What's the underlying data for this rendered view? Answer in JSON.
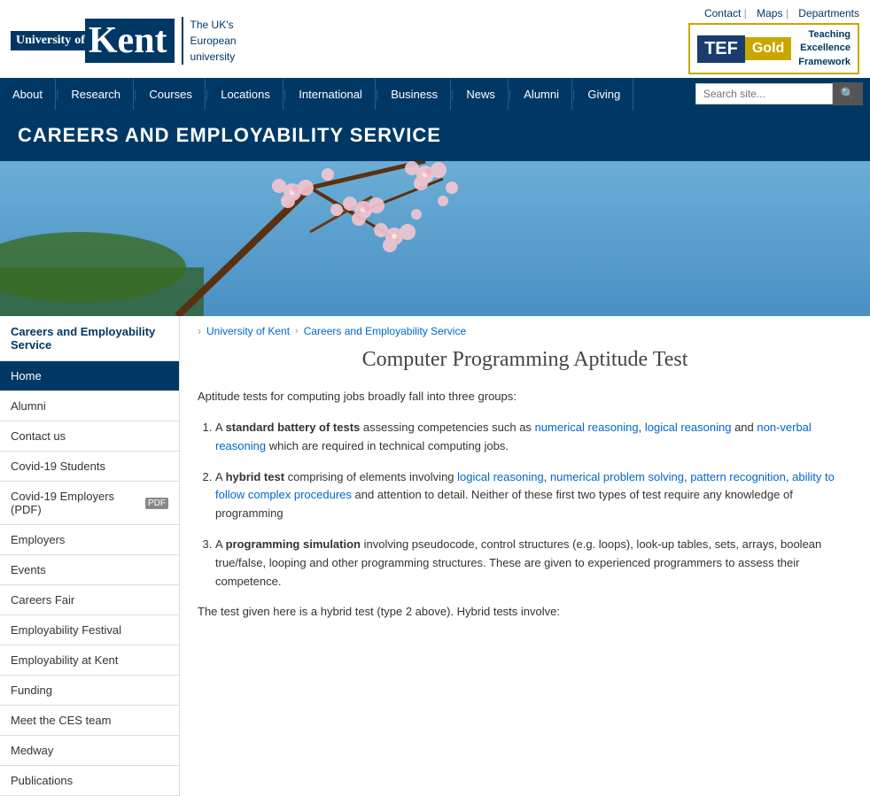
{
  "header": {
    "university_name": "Kent",
    "university_tagline_line1": "The UK's",
    "university_tagline_line2": "European",
    "university_tagline_line3": "university",
    "top_links": [
      {
        "label": "Contact",
        "href": "#"
      },
      {
        "label": "Maps",
        "href": "#"
      },
      {
        "label": "Departments",
        "href": "#"
      }
    ],
    "tef": {
      "logo_text": "TEF",
      "grade": "Gold",
      "label_line1": "Teaching",
      "label_line2": "Excellence",
      "label_line3": "Framework"
    }
  },
  "nav": {
    "items": [
      {
        "label": "About",
        "href": "#"
      },
      {
        "label": "Research",
        "href": "#"
      },
      {
        "label": "Courses",
        "href": "#"
      },
      {
        "label": "Locations",
        "href": "#"
      },
      {
        "label": "International",
        "href": "#"
      },
      {
        "label": "Business",
        "href": "#"
      },
      {
        "label": "News",
        "href": "#"
      },
      {
        "label": "Alumni",
        "href": "#"
      },
      {
        "label": "Giving",
        "href": "#"
      }
    ],
    "search_placeholder": "Search site..."
  },
  "page_banner": {
    "title": "CAREERS AND EMPLOYABILITY SERVICE"
  },
  "sidebar": {
    "section_title_line1": "Careers and Employability",
    "section_title_line2": "Service",
    "items": [
      {
        "label": "Home",
        "href": "#",
        "active": true
      },
      {
        "label": "Alumni",
        "href": "#"
      },
      {
        "label": "Contact us",
        "href": "#"
      },
      {
        "label": "Covid-19 Students",
        "href": "#"
      },
      {
        "label": "Covid-19 Employers (PDF)",
        "href": "#",
        "has_icon": true
      },
      {
        "label": "Employers",
        "href": "#"
      },
      {
        "label": "Events",
        "href": "#"
      },
      {
        "label": "Careers Fair",
        "href": "#"
      },
      {
        "label": "Employability Festival",
        "href": "#"
      },
      {
        "label": "Employability at Kent",
        "href": "#"
      },
      {
        "label": "Funding",
        "href": "#"
      },
      {
        "label": "Meet the CES team",
        "href": "#"
      },
      {
        "label": "Medway",
        "href": "#"
      },
      {
        "label": "Publications",
        "href": "#"
      }
    ]
  },
  "breadcrumb": {
    "items": [
      {
        "label": "University of Kent",
        "href": "#"
      },
      {
        "label": "Careers and Employability Service",
        "href": "#"
      }
    ]
  },
  "article": {
    "title": "Computer Programming Aptitude Test",
    "intro": "Aptitude tests for computing jobs broadly fall into three groups:",
    "list_items": [
      {
        "prefix": "A ",
        "bold_text": "standard battery of tests",
        "text_after_bold": " assessing competencies such as ",
        "links": [
          {
            "label": "numerical reasoning",
            "href": "#"
          },
          {
            "label": "logical reasoning",
            "href": "#"
          },
          {
            "label": "non-verbal reasoning",
            "href": "#"
          }
        ],
        "text_end": " which are required in technical computing jobs.",
        "link_conjunction": ", ",
        "link_prefix": "and "
      },
      {
        "prefix": "A ",
        "bold_text": "hybrid test",
        "text_after_bold": " comprising of elements involving ",
        "links": [
          {
            "label": "logical reasoning",
            "href": "#"
          },
          {
            "label": "numerical problem solving",
            "href": "#"
          },
          {
            "label": "pattern recognition",
            "href": "#"
          },
          {
            "label": "ability to follow complex procedures",
            "href": "#"
          }
        ],
        "text_end": " and attention to detail. Neither of these first two types of test require any knowledge of programming",
        "link_conjunction": ", "
      },
      {
        "prefix": "A ",
        "bold_text": "programming simulation",
        "text_after_bold": " involving pseudocode, control structures (e.g. loops), look-up tables, sets, arrays, boolean true/false, looping and other programming structures. These are given to experienced programmers to assess their competence.",
        "links": []
      }
    ],
    "closing_text": "The test given here is a hybrid test (type 2 above). Hybrid tests involve:"
  }
}
